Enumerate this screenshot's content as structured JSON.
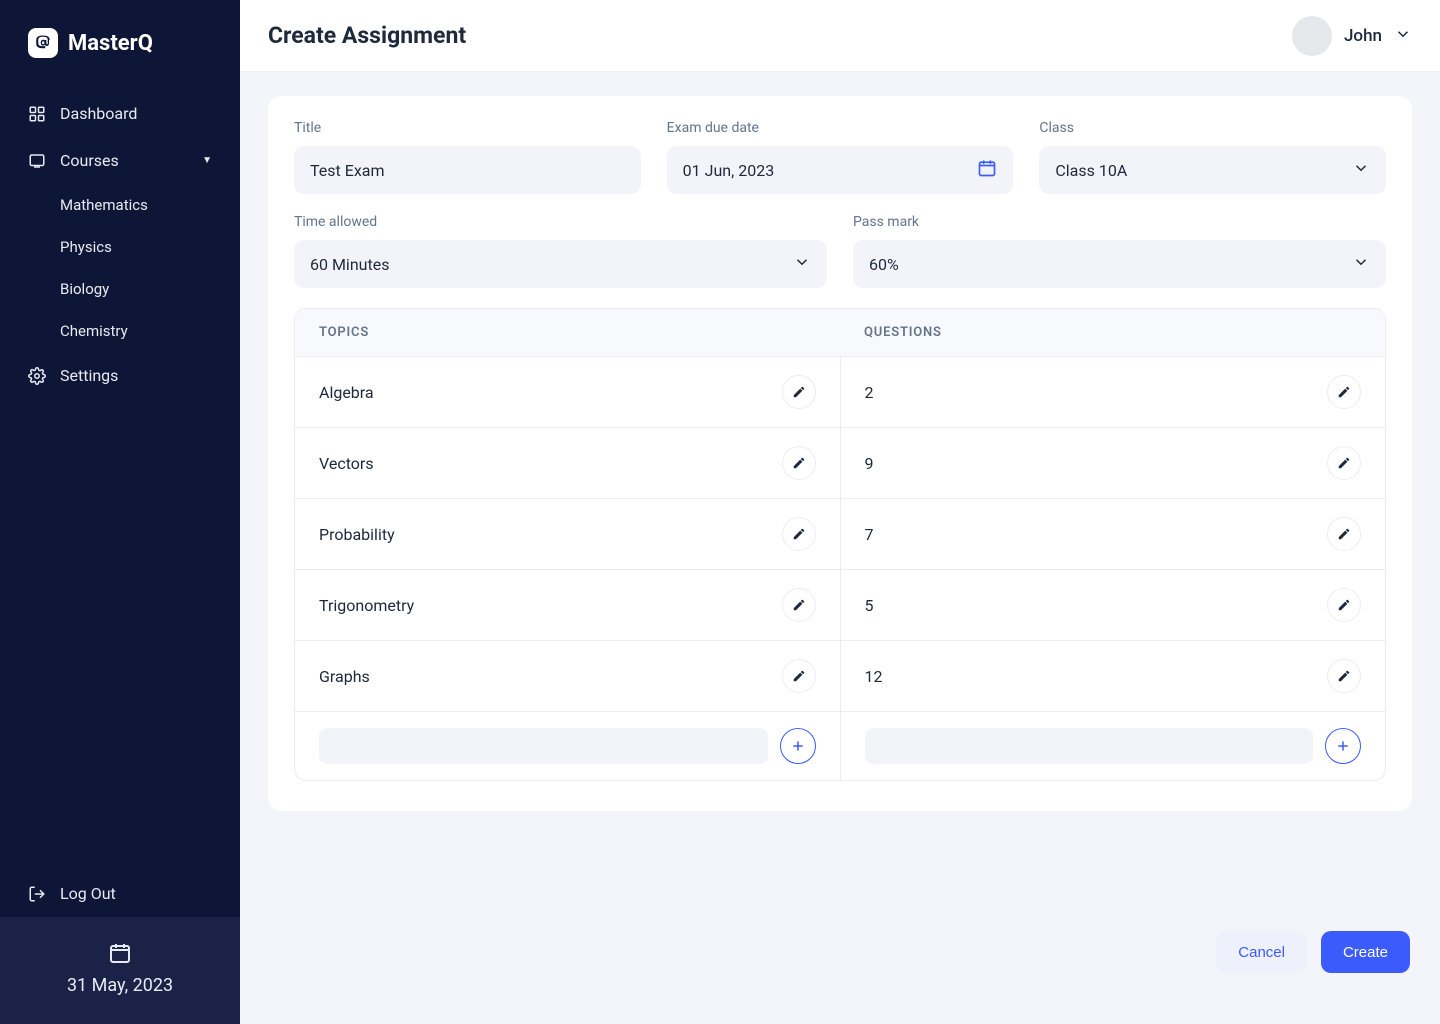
{
  "brand": {
    "name": "MasterQ"
  },
  "sidebar": {
    "dashboard": "Dashboard",
    "courses": "Courses",
    "courseItems": [
      "Mathematics",
      "Physics",
      "Biology",
      "Chemistry"
    ],
    "settings": "Settings",
    "logout": "Log Out",
    "date": "31 May, 2023"
  },
  "header": {
    "title": "Create Assignment",
    "userName": "John"
  },
  "form": {
    "titleLabel": "Title",
    "titleValue": "Test Exam",
    "dueLabel": "Exam due date",
    "dueValue": "01 Jun, 2023",
    "classLabel": "Class",
    "classValue": "Class 10A",
    "timeLabel": "Time allowed",
    "timeValue": "60 Minutes",
    "passLabel": "Pass mark",
    "passValue": "60%"
  },
  "table": {
    "headerTopics": "TOPICS",
    "headerQuestions": "QUESTIONS",
    "rows": [
      {
        "topic": "Algebra",
        "questions": "2"
      },
      {
        "topic": "Vectors",
        "questions": "9"
      },
      {
        "topic": "Probability",
        "questions": "7"
      },
      {
        "topic": "Trigonometry",
        "questions": "5"
      },
      {
        "topic": "Graphs",
        "questions": "12"
      }
    ]
  },
  "actions": {
    "cancel": "Cancel",
    "create": "Create"
  }
}
